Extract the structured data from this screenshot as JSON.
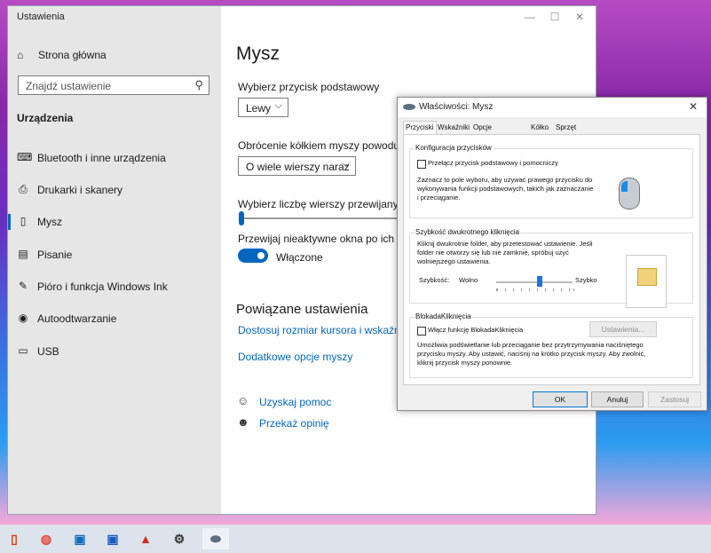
{
  "settings": {
    "title": "Ustawienia",
    "home": "Strona główna",
    "search_placeholder": "Znajdź ustawienie",
    "section": "Urządzenia",
    "nav": [
      {
        "label": "Bluetooth i inne urządzenia",
        "icon": "bluetooth-icon"
      },
      {
        "label": "Drukarki i skanery",
        "icon": "printer-icon"
      },
      {
        "label": "Mysz",
        "icon": "mouse-icon"
      },
      {
        "label": "Pisanie",
        "icon": "keyboard-icon"
      },
      {
        "label": "Pióro i funkcja Windows Ink",
        "icon": "pen-icon"
      },
      {
        "label": "Autoodtwarzanie",
        "icon": "autoplay-icon"
      },
      {
        "label": "USB",
        "icon": "usb-icon"
      }
    ],
    "main": {
      "title": "Mysz",
      "primary_label": "Wybierz przycisk podstawowy",
      "primary_value": "Lewy",
      "wheel_label": "Obrócenie kółkiem myszy powoduje pr",
      "wheel_value": "O wiele wierszy naraz",
      "lines_label": "Wybierz liczbę wierszy przewijanych na",
      "scroll_inactive_label": "Przewijaj nieaktywne okna po ich wska",
      "toggle_state": "Włączone",
      "related_title": "Powiązane ustawienia",
      "link1": "Dostosuj rozmiar kursora i wskaźnika",
      "link2": "Dodatkowe opcje myszy",
      "help": "Uzyskaj pomoc",
      "feedback": "Przekaż opinię"
    }
  },
  "dialog": {
    "title": "Właściwości: Mysz",
    "tabs": [
      "Przyciski",
      "Wskaźniki",
      "Opcje wskaźnika",
      "Kółko",
      "Sprzęt"
    ],
    "g1_title": "Konfiguracja przycisków",
    "g1_checkbox": "Przełącz przycisk podstawowy i pomocniczy",
    "g1_desc": "Zaznacz to pole wyboru, aby używać prawego przycisku do wykonywania funkcji podstawowych, takich jak zaznaczanie i przeciąganie.",
    "g2_title": "Szybkość dwukrotnego kliknięcia",
    "g2_desc": "Kliknij dwukrotnie folder, aby przetestować ustawienie. Jeśli folder nie otworzy się lub nie zamknie, spróbuj użyć wolniejszego ustawienia.",
    "g2_speed": "Szybkość:",
    "g2_slow": "Wolno",
    "g2_fast": "Szybko",
    "g3_title": "BlokadaKliknięcia",
    "g3_checkbox": "Włącz funkcję BlokadaKliknięcia",
    "g3_settings": "Ustawienia...",
    "g3_desc": "Umożliwia podświetlanie lub przeciąganie bez przytrzymywania naciśniętego przycisku myszy. Aby ustawić, naciśnij na krótko przycisk myszy. Aby zwolnić, kliknij przycisk myszy ponownie.",
    "ok": "OK",
    "cancel": "Anuluj",
    "apply": "Zastosuj"
  }
}
